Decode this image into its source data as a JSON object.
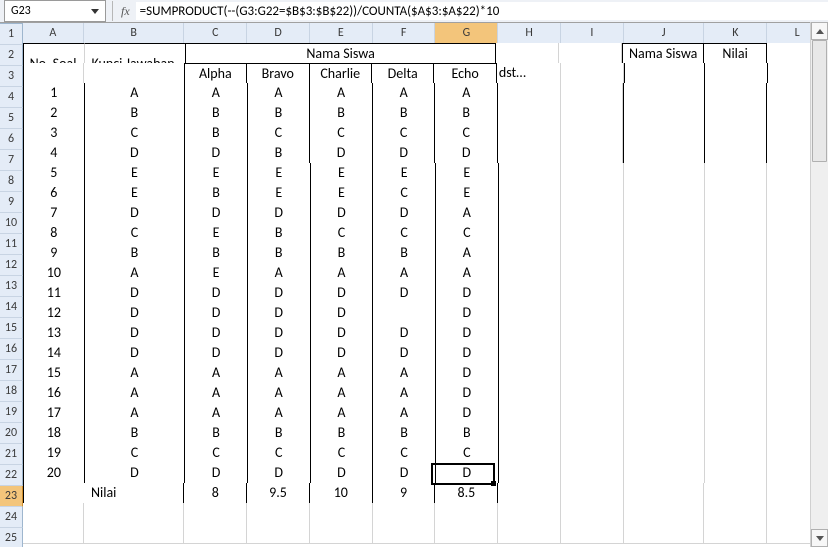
{
  "namebox": "G23",
  "formula": "=SUMPRODUCT(--(G3:G22=$B$3:$B$22))/COUNTA($A$3:$A$22)*10",
  "fx_label": "fx",
  "columns": [
    "A",
    "B",
    "C",
    "D",
    "E",
    "F",
    "G",
    "H",
    "I",
    "J",
    "K",
    "L"
  ],
  "sel_col": "G",
  "sel_row": 23,
  "header": {
    "no_soal": "No. Soal",
    "kunci": "Kunci Jawaban",
    "nama_siswa": "Nama Siswa",
    "students": [
      "Alpha",
      "Bravo",
      "Charlie",
      "Delta",
      "Echo"
    ],
    "dst": "dst…",
    "nama_siswa2": "Nama Siswa",
    "nilai2": "Nilai"
  },
  "rows": [
    {
      "no": "1",
      "k": "A",
      "a": [
        "A",
        "A",
        "A",
        "A",
        "A"
      ]
    },
    {
      "no": "2",
      "k": "B",
      "a": [
        "B",
        "B",
        "B",
        "B",
        "B"
      ]
    },
    {
      "no": "3",
      "k": "C",
      "a": [
        "B",
        "C",
        "C",
        "C",
        "C"
      ]
    },
    {
      "no": "4",
      "k": "D",
      "a": [
        "D",
        "B",
        "D",
        "D",
        "D"
      ]
    },
    {
      "no": "5",
      "k": "E",
      "a": [
        "E",
        "E",
        "E",
        "E",
        "E"
      ]
    },
    {
      "no": "6",
      "k": "E",
      "a": [
        "B",
        "E",
        "E",
        "C",
        "E"
      ]
    },
    {
      "no": "7",
      "k": "D",
      "a": [
        "D",
        "D",
        "D",
        "D",
        "A"
      ]
    },
    {
      "no": "8",
      "k": "C",
      "a": [
        "E",
        "B",
        "C",
        "C",
        "C"
      ]
    },
    {
      "no": "9",
      "k": "B",
      "a": [
        "B",
        "B",
        "B",
        "B",
        "A"
      ]
    },
    {
      "no": "10",
      "k": "A",
      "a": [
        "E",
        "A",
        "A",
        "A",
        "A"
      ]
    },
    {
      "no": "11",
      "k": "D",
      "a": [
        "D",
        "D",
        "D",
        "D",
        "D"
      ]
    },
    {
      "no": "12",
      "k": "D",
      "a": [
        "D",
        "D",
        "D",
        "",
        "D"
      ]
    },
    {
      "no": "13",
      "k": "D",
      "a": [
        "D",
        "D",
        "D",
        "D",
        "D"
      ]
    },
    {
      "no": "14",
      "k": "D",
      "a": [
        "D",
        "D",
        "D",
        "D",
        "D"
      ]
    },
    {
      "no": "15",
      "k": "A",
      "a": [
        "A",
        "A",
        "A",
        "A",
        "D"
      ]
    },
    {
      "no": "16",
      "k": "A",
      "a": [
        "A",
        "A",
        "A",
        "A",
        "D"
      ]
    },
    {
      "no": "17",
      "k": "A",
      "a": [
        "A",
        "A",
        "A",
        "A",
        "D"
      ]
    },
    {
      "no": "18",
      "k": "B",
      "a": [
        "B",
        "B",
        "B",
        "B",
        "B"
      ]
    },
    {
      "no": "19",
      "k": "C",
      "a": [
        "C",
        "C",
        "C",
        "C",
        "C"
      ]
    },
    {
      "no": "20",
      "k": "D",
      "a": [
        "D",
        "D",
        "D",
        "D",
        "D"
      ]
    }
  ],
  "footer": {
    "label": "Nilai",
    "scores": [
      "8",
      "9.5",
      "10",
      "9",
      "8.5"
    ]
  }
}
